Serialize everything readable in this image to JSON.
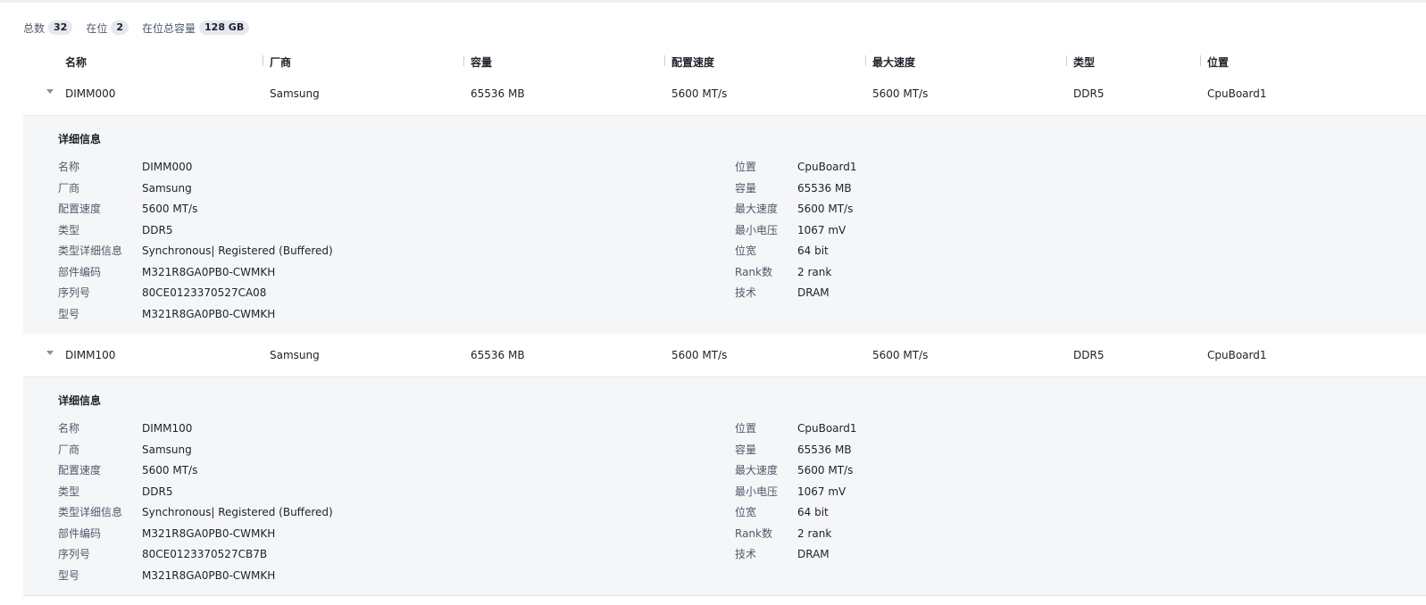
{
  "summary": {
    "total_label": "总数",
    "total_value": "32",
    "present_label": "在位",
    "present_value": "2",
    "capacity_label": "在位总容量",
    "capacity_value": "128 GB"
  },
  "table": {
    "columns": [
      "名称",
      "厂商",
      "容量",
      "配置速度",
      "最大速度",
      "类型",
      "位置"
    ]
  },
  "rows": [
    {
      "cells": [
        "DIMM000",
        "Samsung",
        "65536 MB",
        "5600 MT/s",
        "5600 MT/s",
        "DDR5",
        "CpuBoard1"
      ],
      "detail": {
        "title": "详细信息",
        "left": [
          {
            "k": "名称",
            "v": "DIMM000"
          },
          {
            "k": "厂商",
            "v": "Samsung"
          },
          {
            "k": "配置速度",
            "v": "5600 MT/s"
          },
          {
            "k": "类型",
            "v": "DDR5"
          },
          {
            "k": "类型详细信息",
            "v": "Synchronous| Registered (Buffered)"
          },
          {
            "k": "部件编码",
            "v": "M321R8GA0PB0-CWMKH"
          },
          {
            "k": "序列号",
            "v": "80CE0123370527CA08"
          },
          {
            "k": "型号",
            "v": "M321R8GA0PB0-CWMKH"
          }
        ],
        "right": [
          {
            "k": "位置",
            "v": "CpuBoard1"
          },
          {
            "k": "容量",
            "v": "65536 MB"
          },
          {
            "k": "最大速度",
            "v": "5600 MT/s"
          },
          {
            "k": "最小电压",
            "v": "1067 mV"
          },
          {
            "k": "位宽",
            "v": "64 bit"
          },
          {
            "k": "Rank数",
            "v": "2 rank"
          },
          {
            "k": "技术",
            "v": "DRAM"
          }
        ]
      }
    },
    {
      "cells": [
        "DIMM100",
        "Samsung",
        "65536 MB",
        "5600 MT/s",
        "5600 MT/s",
        "DDR5",
        "CpuBoard1"
      ],
      "detail": {
        "title": "详细信息",
        "left": [
          {
            "k": "名称",
            "v": "DIMM100"
          },
          {
            "k": "厂商",
            "v": "Samsung"
          },
          {
            "k": "配置速度",
            "v": "5600 MT/s"
          },
          {
            "k": "类型",
            "v": "DDR5"
          },
          {
            "k": "类型详细信息",
            "v": "Synchronous| Registered (Buffered)"
          },
          {
            "k": "部件编码",
            "v": "M321R8GA0PB0-CWMKH"
          },
          {
            "k": "序列号",
            "v": "80CE0123370527CB7B"
          },
          {
            "k": "型号",
            "v": "M321R8GA0PB0-CWMKH"
          }
        ],
        "right": [
          {
            "k": "位置",
            "v": "CpuBoard1"
          },
          {
            "k": "容量",
            "v": "65536 MB"
          },
          {
            "k": "最大速度",
            "v": "5600 MT/s"
          },
          {
            "k": "最小电压",
            "v": "1067 mV"
          },
          {
            "k": "位宽",
            "v": "64 bit"
          },
          {
            "k": "Rank数",
            "v": "2 rank"
          },
          {
            "k": "技术",
            "v": "DRAM"
          }
        ]
      }
    }
  ]
}
